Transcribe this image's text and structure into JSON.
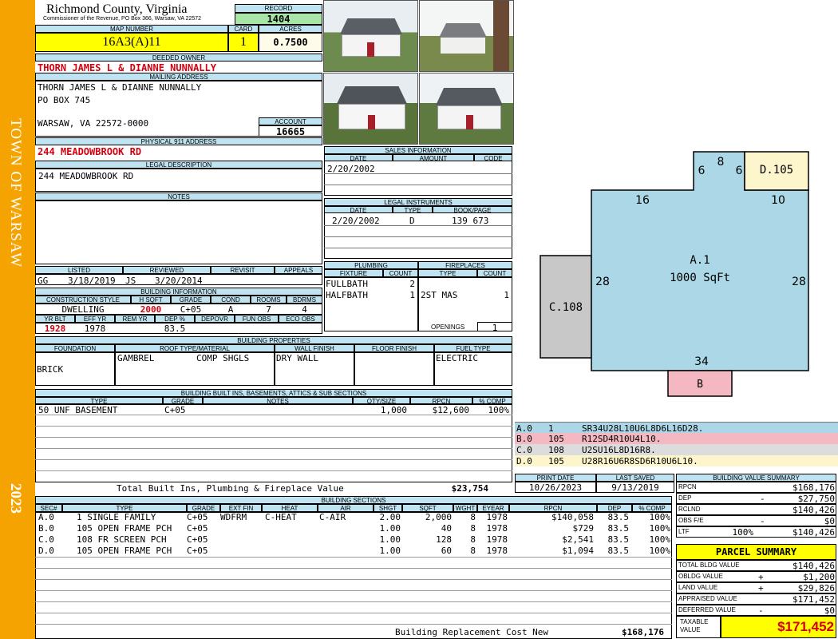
{
  "sidebar": {
    "town": "TOWN OF WARSAW",
    "year": "2023"
  },
  "header": {
    "county": "Richmond County, Virginia",
    "commissioner": "Commissioner of the Revenue, PO Box 366, Warsaw, VA 22572"
  },
  "record": {
    "label": "RECORD",
    "value": "1404"
  },
  "map_number": {
    "label": "MAP NUMBER",
    "value": "16A3(A)11"
  },
  "card": {
    "label": "CARD",
    "value": "1"
  },
  "acres": {
    "label": "ACRES",
    "value": "0.7500"
  },
  "owner": {
    "label": "DEEDED OWNER",
    "value": "THORN JAMES L & DIANNE NUNNALLY"
  },
  "mailing": {
    "label": "MAILING ADDRESS",
    "line1": "THORN JAMES L & DIANNE NUNNALLY",
    "line2": "PO BOX 745",
    "line3": "WARSAW, VA 22572-0000"
  },
  "account": {
    "label": "ACCOUNT",
    "value": "16665"
  },
  "physical": {
    "label": "PHYSICAL 911 ADDRESS",
    "value": "244 MEADOWBROOK RD"
  },
  "legal": {
    "label": "LEGAL DESCRIPTION",
    "value": "244 MEADOWBROOK RD"
  },
  "notes": {
    "label": "NOTES"
  },
  "sales": {
    "label": "SALES INFORMATION",
    "cols": [
      "DATE",
      "AMOUNT",
      "CODE"
    ],
    "date": "2/20/2002"
  },
  "instruments": {
    "label": "LEGAL INSTRUMENTS",
    "cols": [
      "DATE",
      "TYPE",
      "BOOK/PAGE"
    ],
    "date": "2/20/2002",
    "type": "D",
    "book": "139 673"
  },
  "listed": {
    "label": "LISTED",
    "by": "GG",
    "date": "3/18/2019"
  },
  "reviewed": {
    "label": "REVIEWED",
    "by": "JS",
    "date": "3/20/2014"
  },
  "revisit": {
    "label": "REVISIT"
  },
  "appeals": {
    "label": "APPEALS"
  },
  "bldg": {
    "label": "BUILDING INFORMATION",
    "cols": [
      "CONSTRUCTION STYLE",
      "H SQFT",
      "GRADE",
      "COND",
      "ROOMS",
      "BDRMS"
    ],
    "style": "DWELLING",
    "hsqft": "2000",
    "grade": "C+05",
    "cond": "A",
    "rooms": "7",
    "bdrms": "4",
    "cols2": [
      "YR BLT",
      "EFF YR",
      "REM YR",
      "DEP %",
      "DEPOVR",
      "FUN OBS",
      "ECO OBS"
    ],
    "yrblt": "1928",
    "effyr": "1978",
    "dep": "83.5"
  },
  "plumbing": {
    "label": "PLUMBING",
    "cols": [
      "FIXTURE",
      "COUNT"
    ],
    "rows": [
      [
        "FULLBATH",
        "2"
      ],
      [
        "HALFBATH",
        "1"
      ]
    ]
  },
  "fireplaces": {
    "label": "FIREPLACES",
    "cols": [
      "TYPE",
      "COUNT"
    ],
    "type": "2ST MAS",
    "count": "1",
    "openings_label": "OPENINGS",
    "openings": "1"
  },
  "props": {
    "label": "BUILDING PROPERTIES",
    "cols": [
      "FOUNDATION",
      "ROOF TYPE/MATERIAL",
      "WALL FINISH",
      "FLOOR FINISH",
      "FUEL TYPE"
    ],
    "foundation": "BRICK",
    "roof_type": "GAMBREL",
    "roof_mat": "COMP SHGLS",
    "wall": "DRY WALL",
    "fuel": "ELECTRIC"
  },
  "builtins": {
    "label": "BUILDING BUILT INS, BASEMENTS, ATTICS & SUB SECTIONS",
    "cols": [
      "TYPE",
      "GRADE",
      "NOTES",
      "QTY/SIZE",
      "RPCN",
      "% COMP"
    ],
    "row": [
      "50 UNF BASEMENT",
      "C+05",
      "",
      "1,000",
      "$12,600",
      "100%"
    ],
    "total_label": "Total Built Ins, Plumbing & Fireplace Value",
    "total": "$23,754"
  },
  "sketch": {
    "labels": {
      "a": "A.1",
      "a_area": "1000 SqFt",
      "b": "B",
      "c": "C.108",
      "d": "D.105"
    },
    "dims": {
      "top16": "16",
      "top10": "10",
      "d6a": "6",
      "d8": "8",
      "d6b": "6",
      "left28": "28",
      "right28": "28",
      "bottom34": "34"
    },
    "colors": {
      "a": "#acd7e6",
      "b": "#f4b8c3",
      "c": "#c8c8c8",
      "d": "#fdf5cc"
    }
  },
  "legend": [
    {
      "code": "A.0",
      "n": "1",
      "desc": "SR34U28L10U6L8D6L16D28.",
      "color": "#acd7e6"
    },
    {
      "code": "B.0",
      "n": "105",
      "desc": "R12SD4R10U4L10.",
      "color": "#f4b8c3"
    },
    {
      "code": "C.0",
      "n": "108",
      "desc": "U2SU16L8D16R8.",
      "color": "#dcdcdc"
    },
    {
      "code": "D.0",
      "n": "105",
      "desc": "U28R16U6R8SD6R10U6L10.",
      "color": "#fdf5cc"
    }
  ],
  "dates": {
    "print_label": "PRINT DATE",
    "print": "10/26/2023",
    "saved_label": "LAST SAVED",
    "saved": "9/13/2019"
  },
  "sections": {
    "label": "BUILDING SECTIONS",
    "cols": [
      "SEC#",
      "TYPE",
      "GRADE",
      "EXT FIN",
      "HEAT",
      "AIR",
      "SHGT",
      "SQFT",
      "WGHT",
      "EYEAR",
      "RPCN",
      "DEP",
      "% COMP"
    ],
    "rows": [
      [
        "A.0",
        "1 SINGLE FAMILY",
        "C+05",
        "WDFRM",
        "C-HEAT",
        "C-AIR",
        "2.00",
        "2,000",
        "8",
        "1978",
        "$140,058",
        "83.5",
        "100%"
      ],
      [
        "B.0",
        "105 OPEN FRAME PCH",
        "C+05",
        "",
        "",
        "",
        "1.00",
        "40",
        "8",
        "1978",
        "$729",
        "83.5",
        "100%"
      ],
      [
        "C.0",
        "108 FR SCREEN PCH",
        "C+05",
        "",
        "",
        "",
        "1.00",
        "128",
        "8",
        "1978",
        "$2,541",
        "83.5",
        "100%"
      ],
      [
        "D.0",
        "105 OPEN FRAME PCH",
        "C+05",
        "",
        "",
        "",
        "1.00",
        "60",
        "8",
        "1978",
        "$1,094",
        "83.5",
        "100%"
      ]
    ],
    "replacement_label": "Building Replacement Cost New",
    "replacement": "$168,176"
  },
  "bvs": {
    "label": "BUILDING VALUE SUMMARY",
    "rows": [
      [
        "RPCN",
        "",
        "$168,176"
      ],
      [
        "DEP",
        "-",
        "$27,750"
      ],
      [
        "RCLND",
        "",
        "$140,426"
      ],
      [
        "OBS F/E",
        "-",
        "$0"
      ],
      [
        "LTF",
        "100%",
        "$140,426"
      ]
    ]
  },
  "parcel": {
    "label": "PARCEL SUMMARY",
    "rows": [
      [
        "TOTAL BLDG VALUE",
        "",
        "$140,426"
      ],
      [
        "OBLDG VALUE",
        "+",
        "$1,200"
      ],
      [
        "LAND VALUE",
        "+",
        "$29,826"
      ],
      [
        "APPRAISED VALUE",
        "",
        "$171,452"
      ],
      [
        "DEFERRED VALUE",
        "-",
        "$0"
      ]
    ],
    "taxable_label": "TAXABLE VALUE",
    "taxable": "$171,452"
  }
}
